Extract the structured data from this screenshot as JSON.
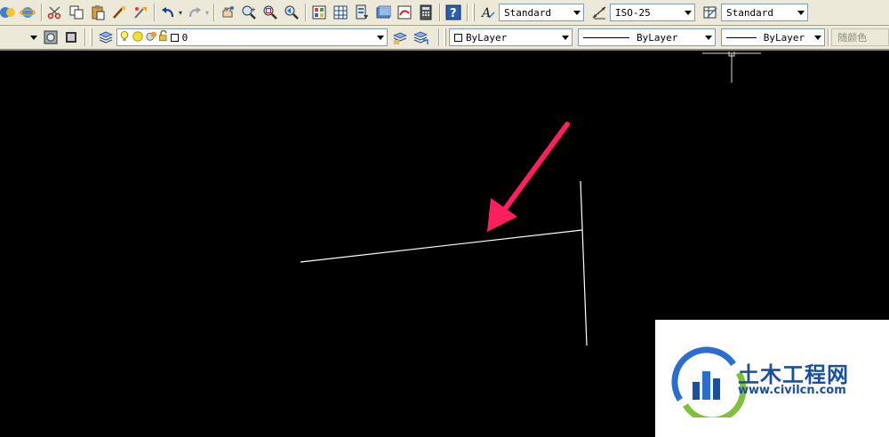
{
  "toolbar_top": {
    "text_style": "Standard",
    "dim_style": "ISO-25",
    "table_style": "Standard"
  },
  "toolbar_layers": {
    "layer_name": "0",
    "color": "ByLayer",
    "linetype": "ByLayer",
    "lineweight": "ByLayer",
    "plot_style": "随颜色"
  },
  "accent": {
    "arrow_color": "#ff1f5e",
    "line_color": "#ffffff",
    "canvas_bg": "#000000"
  },
  "watermark": {
    "title": "土木工程网",
    "url": "www.civilcn.com"
  },
  "icons": [
    "pan-icon",
    "orbit-icon",
    "cut-icon",
    "copy-icon",
    "paste-icon",
    "match-properties-icon",
    "brush-icon",
    "undo-icon",
    "redo-icon",
    "pan-realtime-icon",
    "zoom-realtime-icon",
    "zoom-window-icon",
    "zoom-previous-icon",
    "properties-icon",
    "design-center-icon",
    "tool-palettes-icon",
    "sheet-set-icon",
    "markup-icon",
    "calculator-icon",
    "help-icon",
    "text-style-icon",
    "dim-style-icon",
    "table-style-icon",
    "layer-dropdown-icon",
    "layer-state-icon",
    "make-current-icon",
    "layer-previous-icon",
    "bulb-icon",
    "sun-icon",
    "freeze-icon",
    "lock-icon"
  ]
}
